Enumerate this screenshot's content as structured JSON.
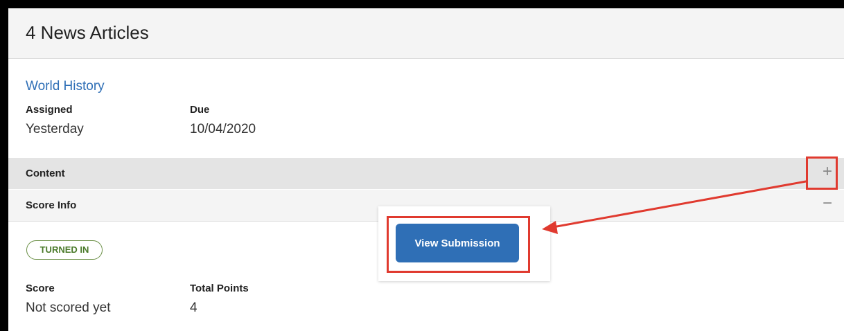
{
  "header": {
    "title": "4 News Articles"
  },
  "assignment": {
    "course": "World History",
    "assigned_label": "Assigned",
    "assigned_value": "Yesterday",
    "due_label": "Due",
    "due_value": "10/04/2020"
  },
  "sections": {
    "content": {
      "label": "Content",
      "toggle": "+"
    },
    "score_info": {
      "label": "Score Info",
      "toggle": "−"
    }
  },
  "score": {
    "status": "TURNED IN",
    "score_label": "Score",
    "score_value": "Not scored yet",
    "total_label": "Total Points",
    "total_value": "4"
  },
  "popup": {
    "button_label": "View Submission"
  },
  "colors": {
    "accent": "#2f6fb6",
    "callout": "#e03a2f",
    "status": "#4a7a2a"
  }
}
